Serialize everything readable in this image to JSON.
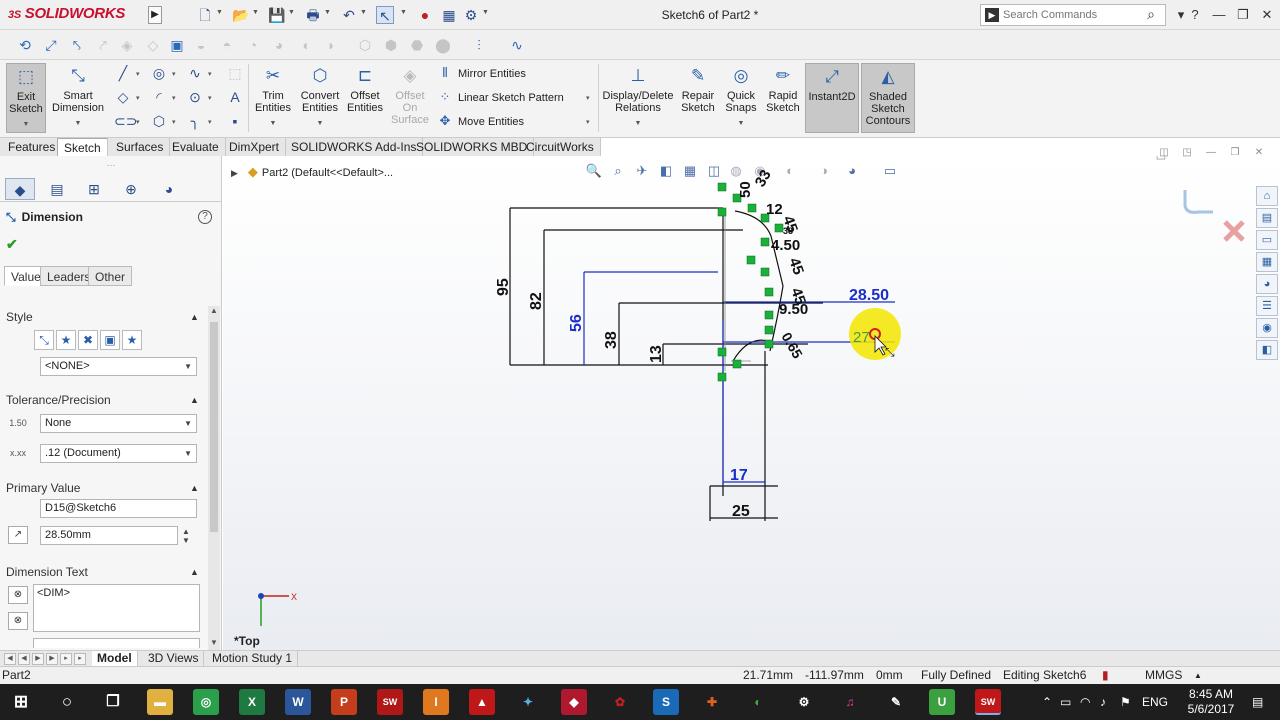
{
  "app": {
    "logo": "SOLIDWORKS",
    "logo_prefix": "3S",
    "document_title": "Sketch6 of Part2 *",
    "search_placeholder": "Search Commands"
  },
  "ribbon": {
    "exit_sketch": "Exit Sketch",
    "smart_dimension": "Smart Dimension",
    "trim_entities": "Trim Entities",
    "convert_entities": "Convert Entities",
    "offset_entities": "Offset Entities",
    "offset_on_surface": "Offset On Surface",
    "mirror_entities": "Mirror Entities",
    "linear_sketch_pattern": "Linear Sketch Pattern",
    "move_entities": "Move Entities",
    "display_delete_relations": "Display/Delete Relations",
    "repair_sketch": "Repair Sketch",
    "quick_snaps": "Quick Snaps",
    "rapid_sketch": "Rapid Sketch",
    "instant2d": "Instant2D",
    "shaded_sketch_contours": "Shaded Sketch Contours"
  },
  "tabs": [
    "Features",
    "Sketch",
    "Surfaces",
    "Evaluate",
    "DimXpert",
    "SOLIDWORKS Add-Ins",
    "SOLIDWORKS MBD",
    "CircuitWorks"
  ],
  "property_manager": {
    "title": "Dimension",
    "tabs": [
      "Value",
      "Leaders",
      "Other"
    ],
    "style_label": "Style",
    "style_value": "<NONE>",
    "tolerance_label": "Tolerance/Precision",
    "tolerance_value": "None",
    "precision_value": ".12 (Document)",
    "tol_icon_1": "1.50",
    "tol_icon_2": "x.xx",
    "primary_label": "Primary Value",
    "primary_name": "D15@Sketch6",
    "primary_value": "28.50mm",
    "dim_text_label": "Dimension Text",
    "dim_text_value": "<DIM>"
  },
  "graphics": {
    "tree_node": "Part2  (Default<<Default>...",
    "view_label": "*Top",
    "axis_x": "X",
    "axis_y": "Y"
  },
  "sketch_dims": {
    "d95": "95",
    "d82": "82",
    "d56": "56",
    "d38": "38",
    "d13": "13",
    "d17": "17",
    "d25": "25",
    "d2850": "28.50",
    "d27": "27",
    "d33": "33",
    "d50": "50",
    "d12": "12",
    "d45a": "45",
    "d38b": "38",
    "d450": "4.50",
    "d45b": "45",
    "d45c": "45",
    "d950": "9.50",
    "d065": "0.65"
  },
  "model_tabs": [
    "Model",
    "3D Views",
    "Motion Study 1"
  ],
  "status": {
    "doc": "Part2",
    "x": "21.71mm",
    "y": "-111.97mm",
    "z": "0mm",
    "state": "Fully Defined",
    "editing": "Editing Sketch6",
    "units": "MMGS"
  },
  "taskbar": {
    "time": "8:45 AM",
    "date": "5/6/2017",
    "lang": "ENG"
  },
  "colors": {
    "dim_blue": "#1a2fc8",
    "dim_black": "#111111",
    "point_green": "#1bb03a",
    "highlight": "#f4e600",
    "brand_red": "#c8102e"
  }
}
